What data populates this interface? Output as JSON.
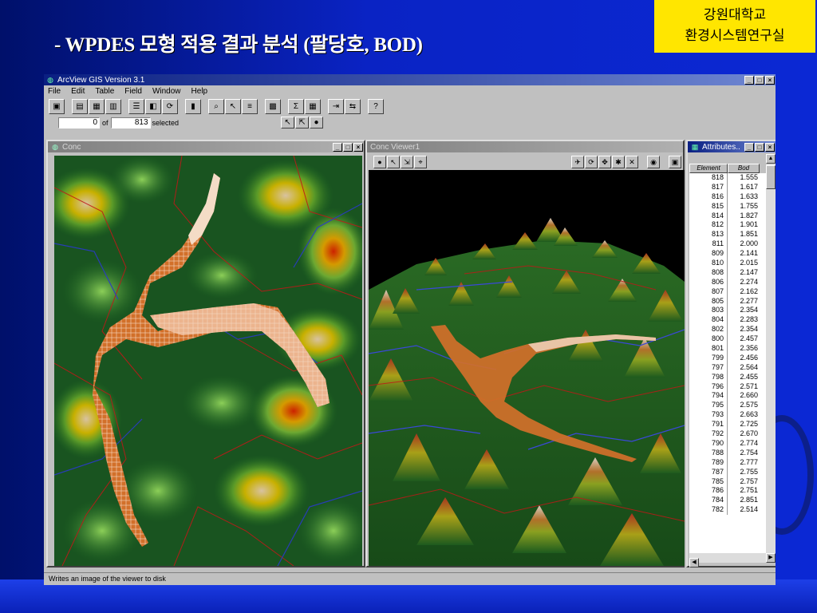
{
  "slide": {
    "title": "- WPDES 모형 적용 결과 분석 (팔당호, BOD)",
    "tag_line1": "강원대학교",
    "tag_line2": "환경시스템연구실"
  },
  "app": {
    "title": "ArcView GIS Version 3.1",
    "menu": [
      "File",
      "Edit",
      "Table",
      "Field",
      "Window",
      "Help"
    ],
    "selected_count": "0",
    "of_label": "of",
    "total_count": "813",
    "selected_label": "selected",
    "status_text": "Writes an image of the viewer to disk"
  },
  "windows": {
    "conc": {
      "title": "Conc"
    },
    "viewer": {
      "title": "Conc Viewer1"
    },
    "attr": {
      "title": "Attributes...",
      "columns": [
        "Element",
        "Bod"
      ],
      "rows": [
        [
          "818",
          "1.555"
        ],
        [
          "817",
          "1.617"
        ],
        [
          "816",
          "1.633"
        ],
        [
          "815",
          "1.755"
        ],
        [
          "814",
          "1.827"
        ],
        [
          "812",
          "1.901"
        ],
        [
          "813",
          "1.851"
        ],
        [
          "811",
          "2.000"
        ],
        [
          "809",
          "2.141"
        ],
        [
          "810",
          "2.015"
        ],
        [
          "808",
          "2.147"
        ],
        [
          "806",
          "2.274"
        ],
        [
          "807",
          "2.162"
        ],
        [
          "805",
          "2.277"
        ],
        [
          "803",
          "2.354"
        ],
        [
          "804",
          "2.283"
        ],
        [
          "802",
          "2.354"
        ],
        [
          "800",
          "2.457"
        ],
        [
          "801",
          "2.356"
        ],
        [
          "799",
          "2.456"
        ],
        [
          "797",
          "2.564"
        ],
        [
          "798",
          "2.455"
        ],
        [
          "796",
          "2.571"
        ],
        [
          "794",
          "2.660"
        ],
        [
          "795",
          "2.575"
        ],
        [
          "793",
          "2.663"
        ],
        [
          "791",
          "2.725"
        ],
        [
          "792",
          "2.670"
        ],
        [
          "790",
          "2.774"
        ],
        [
          "788",
          "2.754"
        ],
        [
          "789",
          "2.777"
        ],
        [
          "787",
          "2.755"
        ],
        [
          "785",
          "2.757"
        ],
        [
          "786",
          "2.751"
        ],
        [
          "784",
          "2.851"
        ],
        [
          "782",
          "2.514"
        ]
      ]
    }
  },
  "colors": {
    "brand_yellow": "#ffe600",
    "slide_blue": "#0b28d4",
    "plume_orange": "#d2702a"
  }
}
